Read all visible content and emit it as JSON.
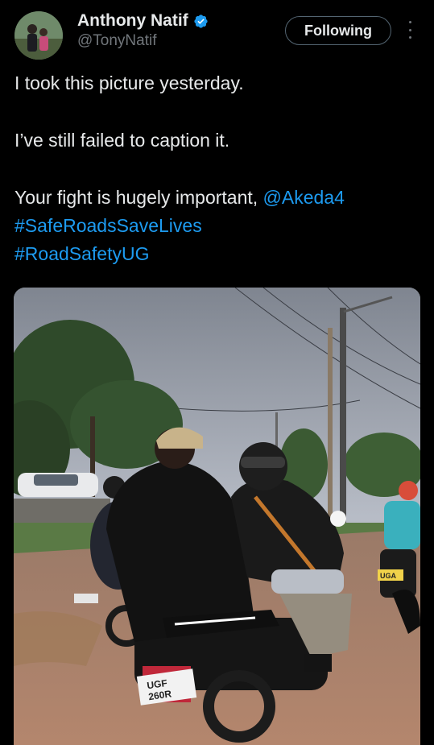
{
  "author": {
    "display_name": "Anthony Natif",
    "handle": "@TonyNatif",
    "avatar_icon": "avatar-photo",
    "verified_icon": "verified-badge-icon",
    "verified_color": "#1d9bf0"
  },
  "follow_button": {
    "label": "Following"
  },
  "more_icon": "more-vertical-icon",
  "tweet": {
    "line1": "I took this picture yesterday.",
    "line2": "I’ve still failed to caption it.",
    "line3_text": "Your fight is hugely important, ",
    "mention": "@Akeda4",
    "hashtag1": "#SafeRoadsSaveLives",
    "hashtag2": "#RoadSafetyUG"
  },
  "media": {
    "description_icon": "photo",
    "plate_front": "UGF\n260R",
    "plate_right": "UGA\n993"
  },
  "colors": {
    "background": "#000000",
    "text": "#e7e9ea",
    "secondary": "#71767b",
    "link": "#1d9bf0"
  }
}
